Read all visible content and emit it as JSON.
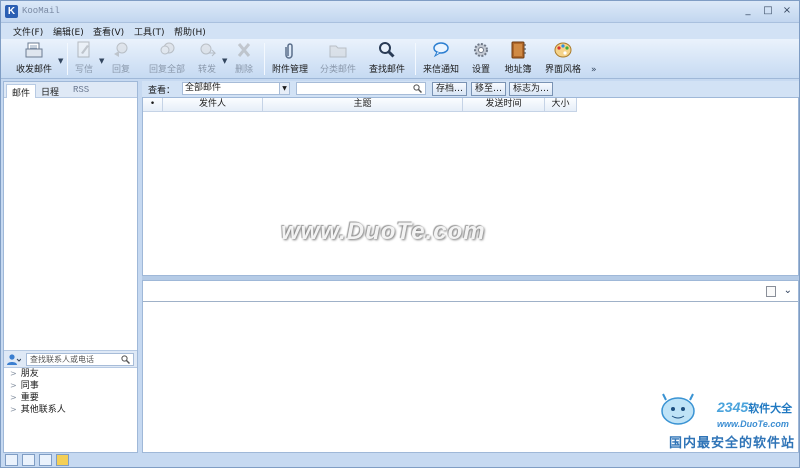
{
  "window": {
    "title": "KooMail",
    "app_icon": "K",
    "minimize": "_",
    "maximize": "□",
    "close": "×"
  },
  "menu": [
    "文件(F)",
    "编辑(E)",
    "查看(V)",
    "工具(T)",
    "帮助(H)"
  ],
  "toolbar": {
    "send_receive": "收发邮件",
    "compose": "写信",
    "reply": "回复",
    "reply_all": "回复全部",
    "forward": "转发",
    "delete": "删除",
    "attachments": "附件管理",
    "classify": "分类邮件",
    "find": "查找邮件",
    "notify": "来信通知",
    "settings": "设置",
    "address_book": "地址簿",
    "skin": "界面风格",
    "more": "»"
  },
  "left_tabs": [
    "邮件",
    "日程",
    "RSS"
  ],
  "contacts": {
    "search_placeholder": "查找联系人或电话",
    "groups": [
      "朋友",
      "同事",
      "重要",
      "其他联系人"
    ]
  },
  "filter": {
    "label": "查看：",
    "selected": "全部邮件",
    "archive": "存档…",
    "move_to": "移至…",
    "flag_as": "标志为…"
  },
  "columns": [
    "•",
    "发件人",
    "主题",
    "发送时间",
    "大小"
  ],
  "watermark": {
    "main": "www.DuoTe.com",
    "brand_digits": "2345",
    "brand_name": "软件大全",
    "url": "www.DuoTe.com",
    "slogan": "国内最安全的软件站"
  },
  "colors": {
    "accent": "#2b5fb3",
    "frame": "#c6d9f1"
  }
}
